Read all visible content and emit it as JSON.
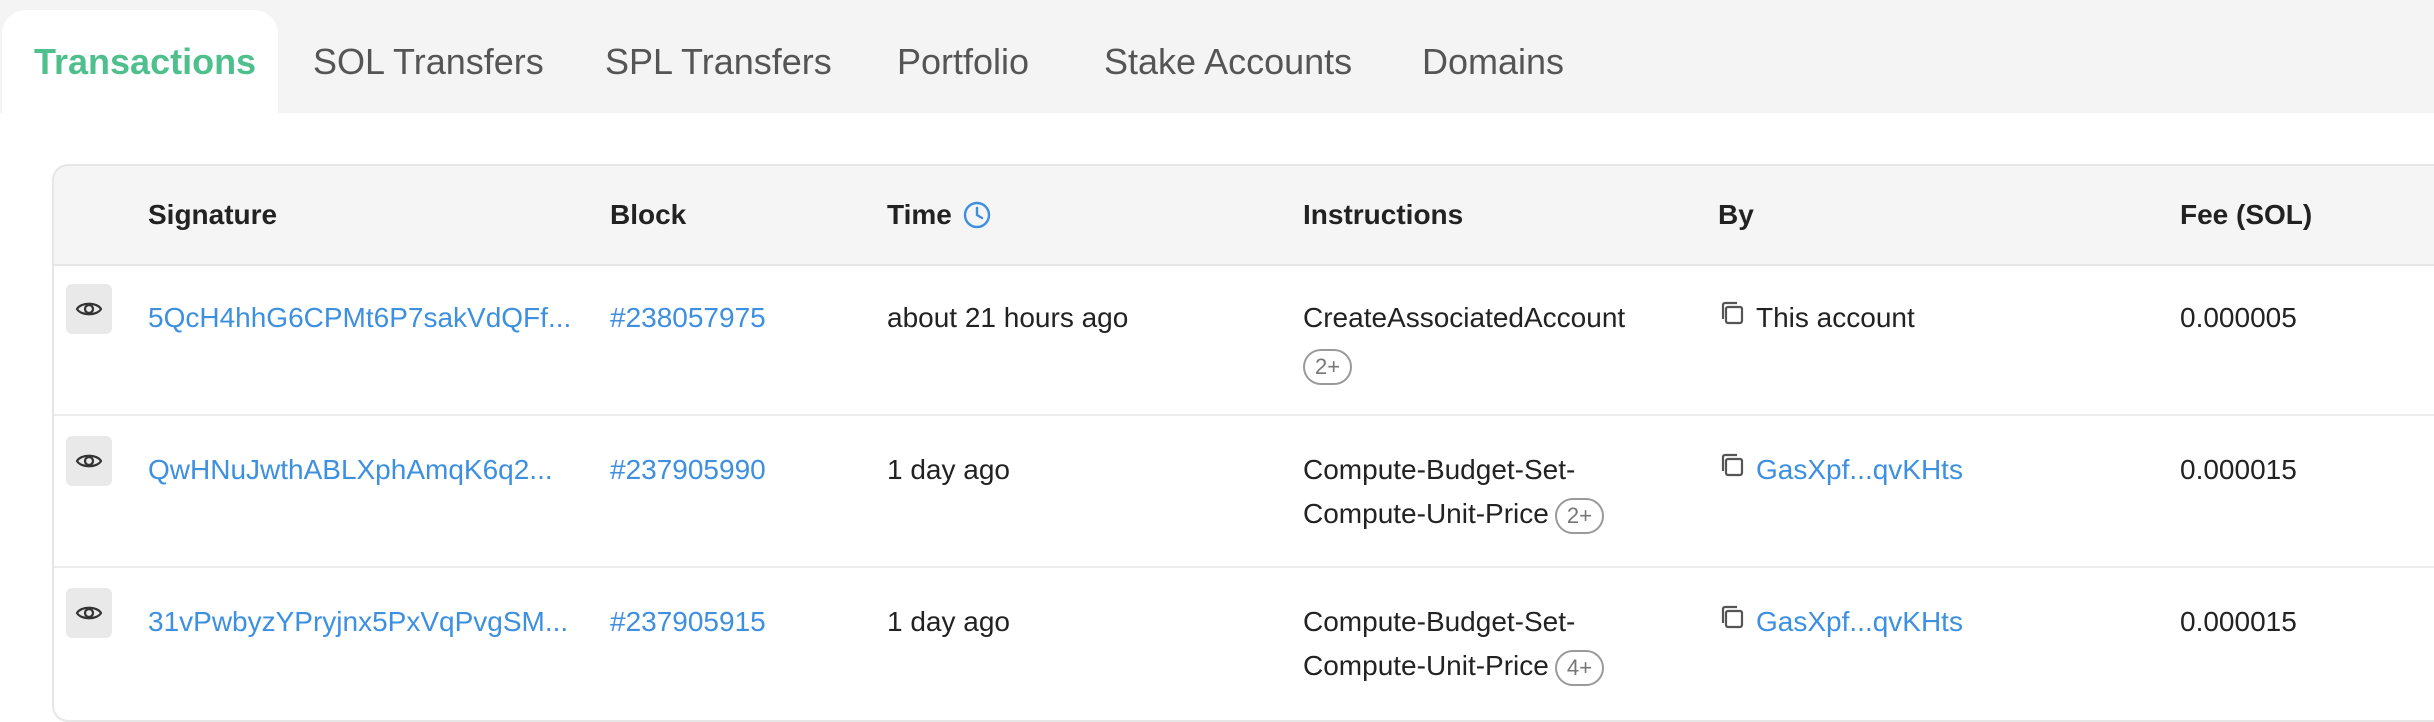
{
  "tabs": [
    {
      "label": "Transactions",
      "active": true
    },
    {
      "label": "SOL Transfers",
      "active": false
    },
    {
      "label": "SPL Transfers",
      "active": false
    },
    {
      "label": "Portfolio",
      "active": false
    },
    {
      "label": "Stake Accounts",
      "active": false
    },
    {
      "label": "Domains",
      "active": false
    }
  ],
  "table": {
    "headers": {
      "signature": "Signature",
      "block": "Block",
      "time": "Time",
      "instructions": "Instructions",
      "by": "By",
      "fee": "Fee (SOL)"
    },
    "rows": [
      {
        "signature": "5QcH4hhG6CPMt6P7sakVdQFf...",
        "block": "#238057975",
        "time": "about 21 hours ago",
        "instruction_line1": "CreateAssociatedAccount",
        "instruction_line2": "",
        "badge": "2+",
        "by": "This account",
        "by_is_link": false,
        "fee": "0.000005"
      },
      {
        "signature": "QwHNuJwthABLXphAmqK6q2...",
        "block": "#237905990",
        "time": "1 day ago",
        "instruction_line1": "Compute-Budget-Set-",
        "instruction_line2": "Compute-Unit-Price",
        "badge": "2+",
        "by": "GasXpf...qvKHts",
        "by_is_link": true,
        "fee": "0.000015"
      },
      {
        "signature": "31vPwbyzYPryjnx5PxVqPvgSM...",
        "block": "#237905915",
        "time": "1 day ago",
        "instruction_line1": "Compute-Budget-Set-",
        "instruction_line2": "Compute-Unit-Price",
        "badge": "4+",
        "by": "GasXpf...qvKHts",
        "by_is_link": true,
        "fee": "0.000015"
      }
    ]
  },
  "colors": {
    "accent": "#4fc08d",
    "link": "#3d8fe0"
  },
  "icons": {
    "time_header": "clock-icon",
    "view": "eye-icon",
    "copy": "copy-icon"
  }
}
